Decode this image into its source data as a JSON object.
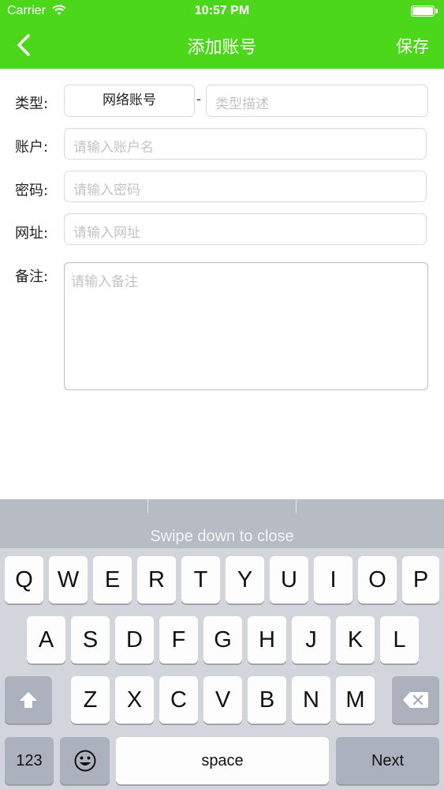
{
  "status_bar": {
    "carrier": "Carrier",
    "time": "10:57 PM"
  },
  "nav": {
    "title": "添加账号",
    "save_label": "保存",
    "back_icon": "chevron-left-icon"
  },
  "form": {
    "type_label": "类型:",
    "type_value": "网络账号",
    "type_separator": "-",
    "type_desc_placeholder": "类型描述",
    "account_label": "账户:",
    "account_placeholder": "请输入账户名",
    "password_label": "密码:",
    "password_placeholder": "请输入密码",
    "url_label": "网址:",
    "url_placeholder": "请输入网址",
    "notes_label": "备注:",
    "notes_placeholder": "请输入备注"
  },
  "keyboard": {
    "hint": "Swipe down to close",
    "row1": [
      "Q",
      "W",
      "E",
      "R",
      "T",
      "Y",
      "U",
      "I",
      "O",
      "P"
    ],
    "row2": [
      "A",
      "S",
      "D",
      "F",
      "G",
      "H",
      "J",
      "K",
      "L"
    ],
    "row3": [
      "Z",
      "X",
      "C",
      "V",
      "B",
      "N",
      "M"
    ],
    "numbers_label": "123",
    "space_label": "space",
    "next_label": "Next",
    "shift_icon": "shift-arrow-icon",
    "delete_icon": "backspace-icon",
    "emoji_icon": "emoji-smiley-icon"
  },
  "colors": {
    "accent": "#4cd71b",
    "keyboard_bg": "#d2d5db",
    "key_dark": "#acb2bd"
  }
}
